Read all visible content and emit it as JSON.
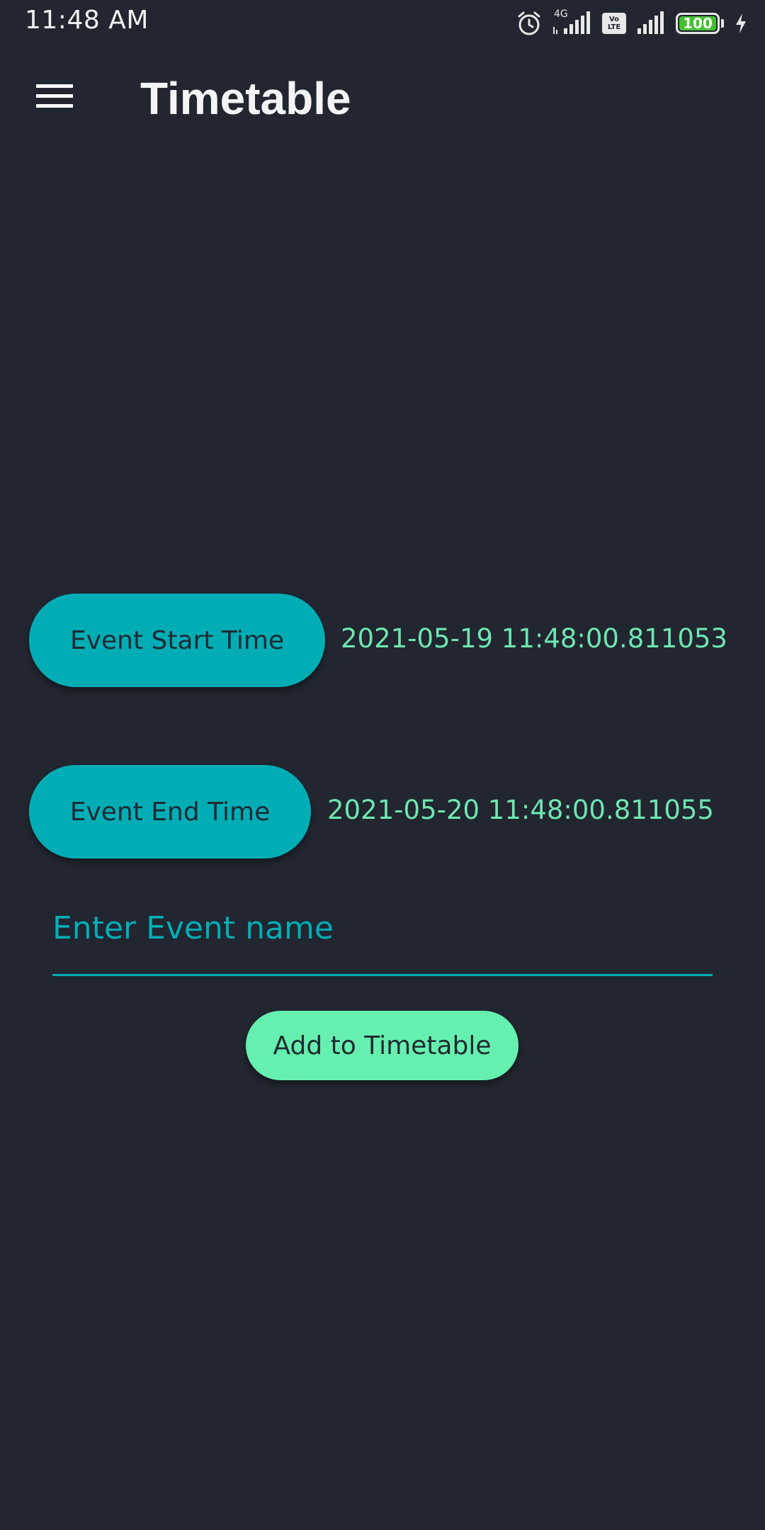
{
  "status_bar": {
    "time": "11:48 AM",
    "network_label": "4G",
    "volte_label": "Vo LTE",
    "battery_level": "100",
    "icons": [
      "alarm-icon",
      "signal-icon",
      "volte-icon",
      "signal-icon",
      "battery-icon",
      "charging-icon"
    ]
  },
  "app_bar": {
    "title": "Timetable",
    "menu_icon": "menu-icon"
  },
  "event_start": {
    "button_label": "Event Start Time",
    "value": "2021-05-19 11:48:00.811053"
  },
  "event_end": {
    "button_label": "Event End Time",
    "value": "2021-05-20 11:48:00.811055"
  },
  "event_name": {
    "placeholder": "Enter Event name",
    "value": ""
  },
  "add_button": {
    "label": "Add to Timetable"
  },
  "colors": {
    "background": "#212630",
    "accent_teal": "#00adb5",
    "accent_green": "#66f0b0",
    "value_text": "#6fe6b0"
  }
}
